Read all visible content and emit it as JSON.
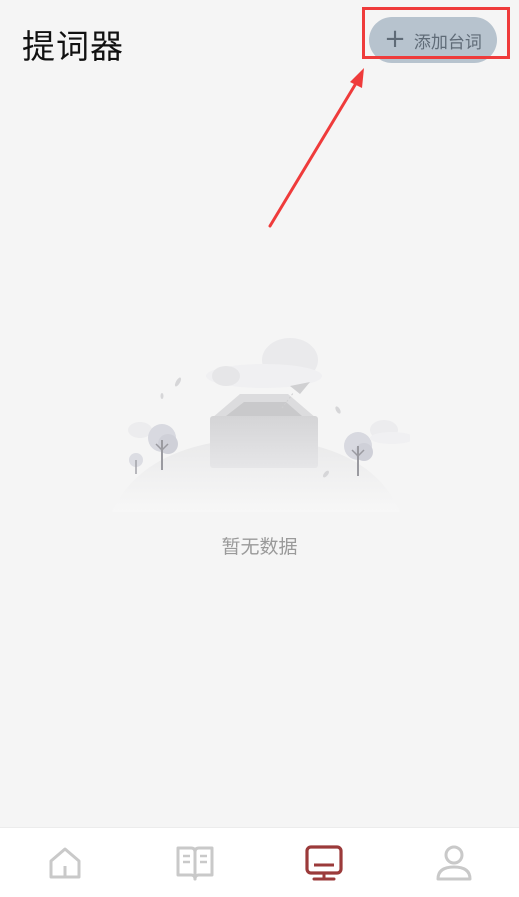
{
  "header": {
    "title": "提词器",
    "add_button_label": "添加台词",
    "add_button_icon": "plus-icon"
  },
  "empty_state": {
    "text": "暂无数据",
    "icon": "empty-box-illustration"
  },
  "bottom_nav": {
    "active_color": "#9b3a3a",
    "inactive_color": "#c9c9c9",
    "items": [
      {
        "icon": "home-icon",
        "active": false
      },
      {
        "icon": "book-icon",
        "active": false
      },
      {
        "icon": "monitor-icon",
        "active": true
      },
      {
        "icon": "user-icon",
        "active": false
      }
    ]
  },
  "annotation": {
    "highlight_color": "#ef3b3b"
  }
}
